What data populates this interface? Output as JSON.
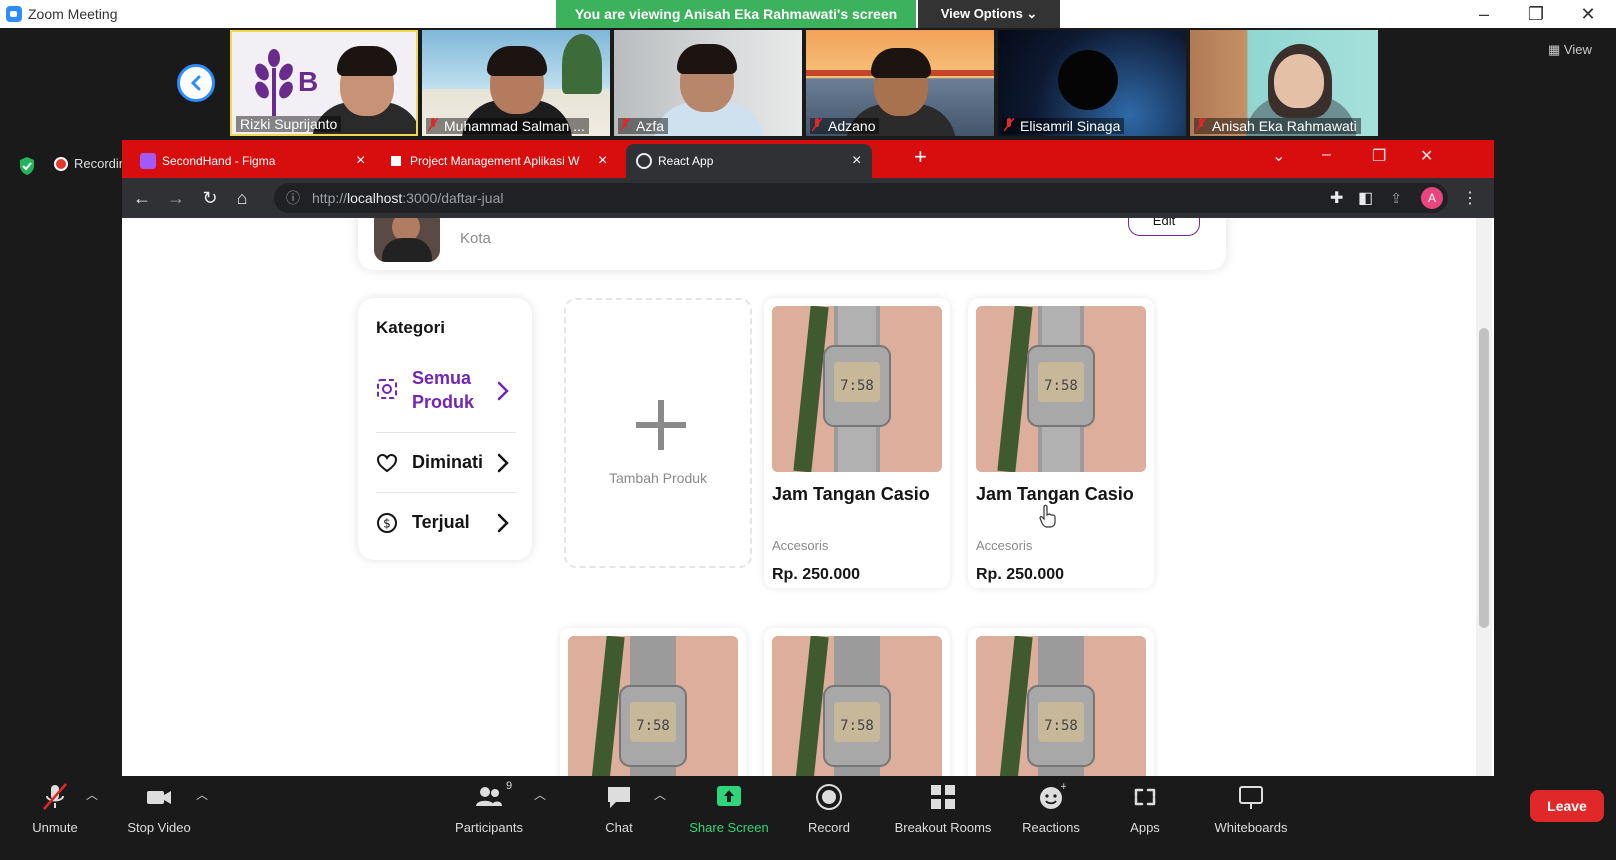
{
  "zoom": {
    "window_title": "Zoom Meeting",
    "share_banner": "You are viewing Anisah Eka Rahmawati's screen",
    "view_options": "View Options ⌄",
    "view_button": "View",
    "recording": "Recording"
  },
  "participants": [
    {
      "name": "Rizki Suprijanto",
      "bg": "#f2f0f5"
    },
    {
      "name": "Muhammad Salman ...",
      "bg": "#8fc1dc"
    },
    {
      "name": "Azfa",
      "bg": "#cfd3d6"
    },
    {
      "name": "Adzano",
      "bg": "#e88a3e"
    },
    {
      "name": "Elisamril Sinaga",
      "bg": "#0e1a33"
    },
    {
      "name": "Anisah Eka Rahmawati",
      "bg": "#8fd6d1"
    }
  ],
  "browser": {
    "tabs": [
      {
        "label": "SecondHand - Figma",
        "favicon": "#a259ff"
      },
      {
        "label": "Project Management Aplikasi W",
        "favicon": "#ffffff"
      },
      {
        "label": "React App",
        "favicon": "#e8eaed"
      }
    ],
    "url_prefix": "http://",
    "url_host": "localhost",
    "url_rest": ":3000/daftar-jual",
    "profile_letter": "A"
  },
  "page": {
    "seller_city": "Kota",
    "edit_label": "Edit",
    "category_title": "Kategori",
    "categories": [
      {
        "label": "Semua Produk",
        "active": true
      },
      {
        "label": "Diminati",
        "active": false
      },
      {
        "label": "Terjual",
        "active": false
      }
    ],
    "add_product_label": "Tambah Produk",
    "products": [
      {
        "name": "Jam Tangan Casio",
        "category": "Accesoris",
        "price": "Rp. 250.000"
      },
      {
        "name": "Jam Tangan Casio",
        "category": "Accesoris",
        "price": "Rp. 250.000"
      }
    ]
  },
  "controls": {
    "unmute": "Unmute",
    "stop_video": "Stop Video",
    "participants": "Participants",
    "participants_count": "9",
    "chat": "Chat",
    "share_screen": "Share Screen",
    "record": "Record",
    "breakout_rooms": "Breakout Rooms",
    "reactions": "Reactions",
    "apps": "Apps",
    "whiteboards": "Whiteboards",
    "leave": "Leave"
  },
  "colors": {
    "accent_purple": "#7126b5",
    "browser_tabbar": "#d80d0d",
    "zoom_green": "#3cb25c",
    "leave_red": "#e02828"
  }
}
